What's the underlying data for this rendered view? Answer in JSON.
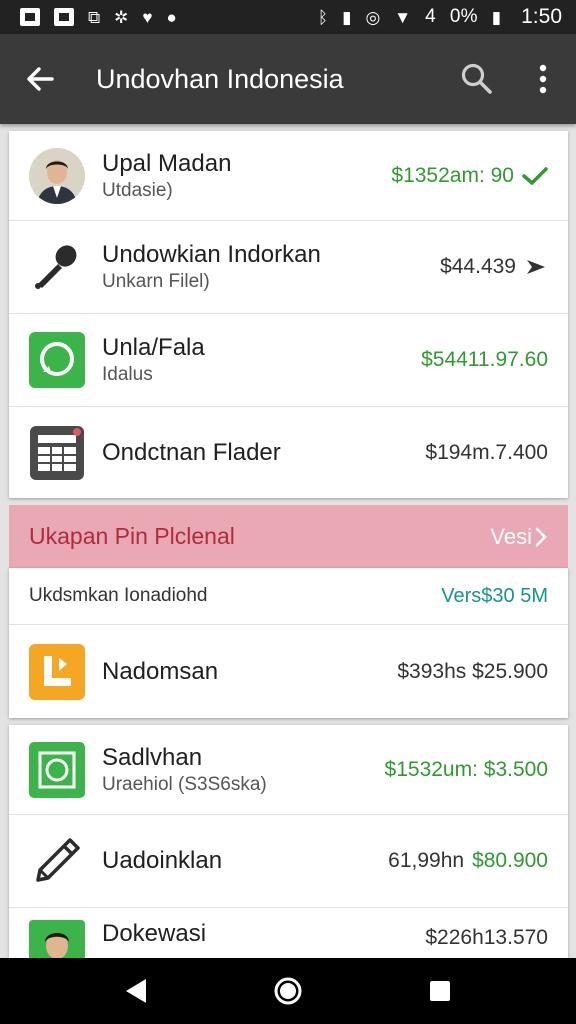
{
  "status_bar": {
    "network_text": "4",
    "battery_text": "0%",
    "time": "1:50"
  },
  "toolbar": {
    "title": "Undovhan Indonesia",
    "icons": [
      "back-arrow-icon",
      "search-icon",
      "more-vert-icon"
    ]
  },
  "card1": {
    "rows": [
      {
        "title": "Upal Madan",
        "subtitle": "Utdasie)",
        "amount": "$1352am: 90",
        "amount_color": "#2f9a2f",
        "icon": "avatar"
      },
      {
        "title": "Undowkian Indorkan",
        "subtitle": "Unkarn Filel)",
        "amount": "$44.439",
        "amount_color": "#333333",
        "icon": "microphone-icon"
      },
      {
        "title": "Unla/Fala",
        "subtitle": "Idalus",
        "amount": "$54411.97.60",
        "amount_color": "#2f9a2f",
        "icon": "chat-bubble-icon"
      },
      {
        "title": "Ondctnan Flader",
        "subtitle": "",
        "amount": "$194m.7.400",
        "amount_color": "#333333",
        "icon": "calculator-icon"
      }
    ]
  },
  "section": {
    "title": "Ukapan Pin Plclenal",
    "link": "Vesi",
    "summary_label": "Ukdsmkan Ionadiohd",
    "summary_value": "Vers$30 5M",
    "row": {
      "title": "Nadomsan",
      "amount": "$393hs $25.900",
      "icon": "orange-app-icon"
    }
  },
  "card3": {
    "rows": [
      {
        "title": "Sadlvhan",
        "subtitle": "Uraehiol (S3S6ska)",
        "amount": "$1532um: $3.500",
        "icon": "green-square-icon"
      },
      {
        "title": "Uadoinklan",
        "subtitle": "",
        "amount_prefix": "61,99hn",
        "amount": "$80.900",
        "icon": "pencil-icon"
      },
      {
        "title": "Dokewasi",
        "subtitle": "",
        "amount": "$226h13.570",
        "icon": "avatar-green"
      }
    ]
  },
  "colors": {
    "toolbar": "#3a3a3a",
    "accent_green": "#2f9a2f",
    "section_header_bg": "#e8a9b4",
    "section_header_text": "#b02c3c",
    "teal": "#17958c"
  }
}
